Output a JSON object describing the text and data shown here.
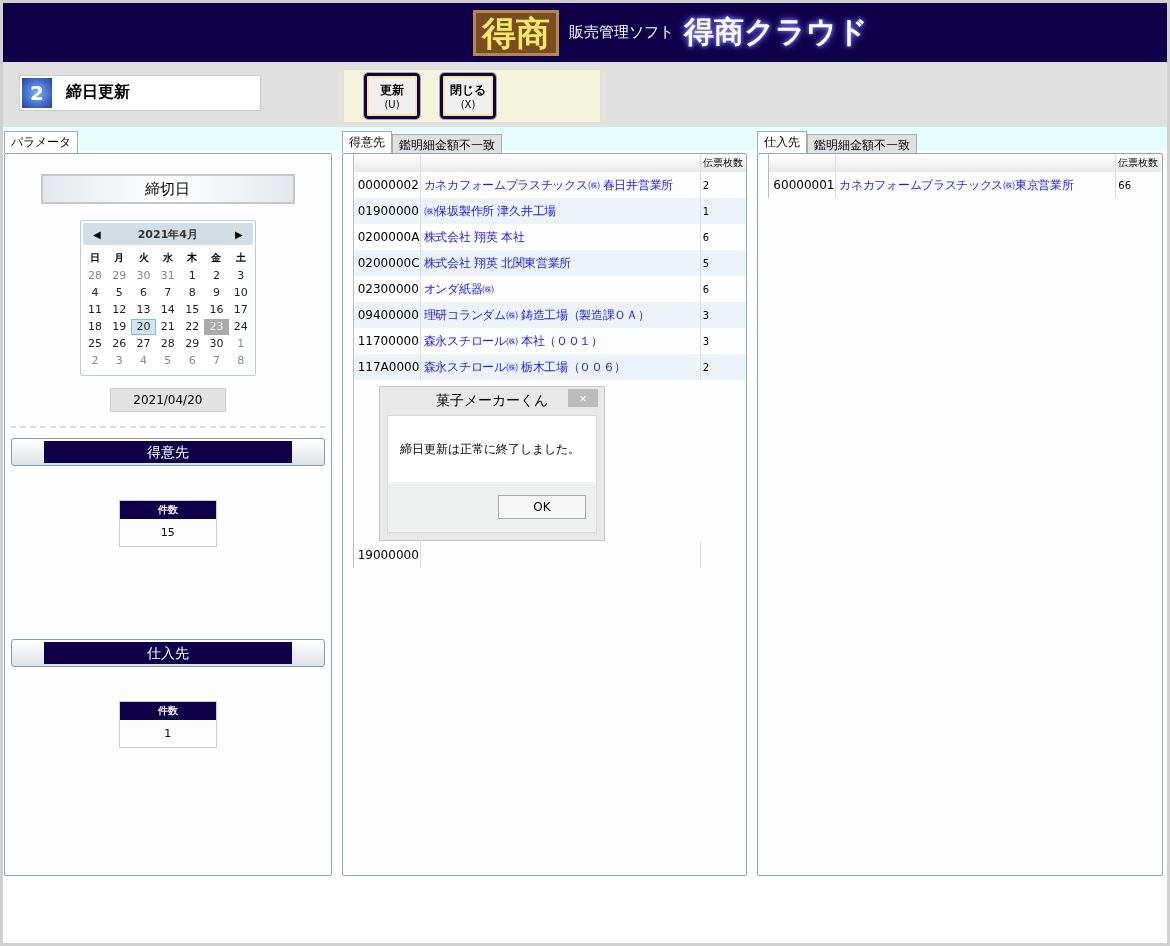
{
  "header": {
    "logo": "得商",
    "subtitle": "販売管理ソフト",
    "product": "得商クラウド"
  },
  "screen": {
    "number": "2",
    "title": "締日更新"
  },
  "toolbar": [
    {
      "label": "更新",
      "key": "(U)"
    },
    {
      "label": "閉じる",
      "key": "(X)"
    }
  ],
  "parameters": {
    "tab": {
      "label": "パラメータ",
      "selected": true
    },
    "heading": "締切日",
    "calendar": {
      "month": "2021年4月",
      "prev": "◀",
      "next": "▶",
      "weekdays": [
        "日",
        "月",
        "火",
        "水",
        "木",
        "金",
        "土"
      ],
      "weeks": [
        [
          {
            "d": "28",
            "other": true,
            "selected": false,
            "today": false
          },
          {
            "d": "29",
            "other": true,
            "selected": false,
            "today": false
          },
          {
            "d": "30",
            "other": true,
            "selected": false,
            "today": false
          },
          {
            "d": "31",
            "other": true,
            "selected": false,
            "today": false
          },
          {
            "d": "1",
            "other": false,
            "selected": false,
            "today": false
          },
          {
            "d": "2",
            "other": false,
            "selected": false,
            "today": false
          },
          {
            "d": "3",
            "other": false,
            "selected": false,
            "today": false
          }
        ],
        [
          {
            "d": "4",
            "other": false,
            "selected": false,
            "today": false
          },
          {
            "d": "5",
            "other": false,
            "selected": false,
            "today": false
          },
          {
            "d": "6",
            "other": false,
            "selected": false,
            "today": false
          },
          {
            "d": "7",
            "other": false,
            "selected": false,
            "today": false
          },
          {
            "d": "8",
            "other": false,
            "selected": false,
            "today": false
          },
          {
            "d": "9",
            "other": false,
            "selected": false,
            "today": false
          },
          {
            "d": "10",
            "other": false,
            "selected": false,
            "today": false
          }
        ],
        [
          {
            "d": "11",
            "other": false,
            "selected": false,
            "today": false
          },
          {
            "d": "12",
            "other": false,
            "selected": false,
            "today": false
          },
          {
            "d": "13",
            "other": false,
            "selected": false,
            "today": false
          },
          {
            "d": "14",
            "other": false,
            "selected": false,
            "today": false
          },
          {
            "d": "15",
            "other": false,
            "selected": false,
            "today": false
          },
          {
            "d": "16",
            "other": false,
            "selected": false,
            "today": false
          },
          {
            "d": "17",
            "other": false,
            "selected": false,
            "today": false
          }
        ],
        [
          {
            "d": "18",
            "other": false,
            "selected": false,
            "today": false
          },
          {
            "d": "19",
            "other": false,
            "selected": false,
            "today": false
          },
          {
            "d": "20",
            "other": false,
            "selected": true,
            "today": false
          },
          {
            "d": "21",
            "other": false,
            "selected": false,
            "today": false
          },
          {
            "d": "22",
            "other": false,
            "selected": false,
            "today": false
          },
          {
            "d": "23",
            "other": false,
            "selected": false,
            "today": true
          },
          {
            "d": "24",
            "other": false,
            "selected": false,
            "today": false
          }
        ],
        [
          {
            "d": "25",
            "other": false,
            "selected": false,
            "today": false
          },
          {
            "d": "26",
            "other": false,
            "selected": false,
            "today": false
          },
          {
            "d": "27",
            "other": false,
            "selected": false,
            "today": false
          },
          {
            "d": "28",
            "other": false,
            "selected": false,
            "today": false
          },
          {
            "d": "29",
            "other": false,
            "selected": false,
            "today": false
          },
          {
            "d": "30",
            "other": false,
            "selected": false,
            "today": false
          },
          {
            "d": "1",
            "other": true,
            "selected": false,
            "today": false
          }
        ],
        [
          {
            "d": "2",
            "other": true,
            "selected": false,
            "today": false
          },
          {
            "d": "3",
            "other": true,
            "selected": false,
            "today": false
          },
          {
            "d": "4",
            "other": true,
            "selected": false,
            "today": false
          },
          {
            "d": "5",
            "other": true,
            "selected": false,
            "today": false
          },
          {
            "d": "6",
            "other": true,
            "selected": false,
            "today": false
          },
          {
            "d": "7",
            "other": true,
            "selected": false,
            "today": false
          },
          {
            "d": "8",
            "other": true,
            "selected": false,
            "today": false
          }
        ]
      ]
    },
    "date": "2021/04/20",
    "sections": [
      {
        "title": "得意先",
        "count_label": "件数",
        "count": "15"
      },
      {
        "title": "仕入先",
        "count_label": "件数",
        "count": "1"
      }
    ]
  },
  "panels": [
    {
      "tabs": [
        {
          "label": "得意先",
          "selected": true
        },
        {
          "label": "鑑明細金額不一致",
          "selected": false
        }
      ],
      "count_header": "伝票枚数",
      "rows": [
        {
          "code": "00000002",
          "name": "カネカフォームプラスチックス㈱ 春日井営業所",
          "count": "2"
        },
        {
          "code": "01900000",
          "name": "㈱保坂製作所 津久井工場",
          "count": "1"
        },
        {
          "code": "0200000A",
          "name": "株式会社 翔英 本社",
          "count": "6"
        },
        {
          "code": "0200000C",
          "name": "株式会社 翔英 北関東営業所",
          "count": "5"
        },
        {
          "code": "02300000",
          "name": "オンダ紙器㈱",
          "count": "6"
        },
        {
          "code": "09400000",
          "name": "理研コランダム㈱ 鋳造工場（製造課ＯＡ）",
          "count": "3"
        },
        {
          "code": "11700000",
          "name": "森永スチロール㈱ 本社（００１）",
          "count": "3"
        },
        {
          "code": "117A0000",
          "name": "森永スチロール㈱ 栃木工場（００６）",
          "count": "2"
        },
        {
          "code": "19000000"
        }
      ]
    },
    {
      "tabs": [
        {
          "label": "仕入先",
          "selected": true
        },
        {
          "label": "鑑明細金額不一致",
          "selected": false
        }
      ],
      "count_header": "伝票枚数",
      "rows": [
        {
          "code": "60000001",
          "name": "カネカフォームプラスチックス㈱東京営業所",
          "count": "66"
        }
      ]
    }
  ],
  "dialog": {
    "title": "菓子メーカーくん",
    "close": "×",
    "message": "締日更新は正常に終了しました。",
    "button": "OK"
  }
}
